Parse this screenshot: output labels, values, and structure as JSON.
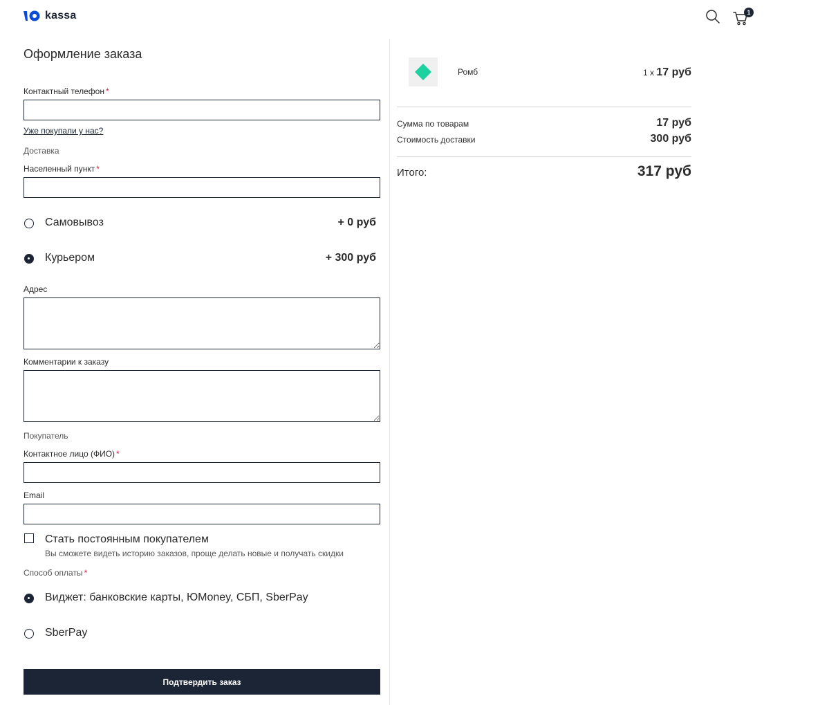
{
  "header": {
    "logo_text": "kassa",
    "logo_icon": "yookassa-logo-icon",
    "search_icon": "search-icon",
    "cart_icon": "cart-icon",
    "cart_count": "1"
  },
  "form": {
    "title": "Оформление заказа",
    "phone_label": "Контактный телефон",
    "phone_value": "",
    "returning_link": "Уже покупали у нас?",
    "delivery_section": "Доставка",
    "city_label": "Населенный пункт",
    "city_value": "",
    "delivery_options": [
      {
        "label": "Самовывоз",
        "price": "+ 0 руб",
        "selected": false
      },
      {
        "label": "Курьером",
        "price": "+ 300 руб",
        "selected": true
      }
    ],
    "address_label": "Адрес",
    "address_value": "",
    "comment_label": "Комментарии к заказу",
    "comment_value": "",
    "buyer_section": "Покупатель",
    "name_label": "Контактное лицо (ФИО)",
    "name_value": "",
    "email_label": "Email",
    "email_value": "",
    "regular_label": "Стать постоянным покупателем",
    "regular_hint": "Вы сможете видеть историю заказов, проще делать новые и получать скидки",
    "regular_checked": false,
    "payment_label": "Способ оплаты",
    "payment_options": [
      {
        "label": "Виджет: банковские карты, ЮMoney, СБП, SberPay",
        "selected": true
      },
      {
        "label": "SberPay",
        "selected": false
      }
    ],
    "required_mark": "*",
    "submit_label": "Подтвердить заказ"
  },
  "summary": {
    "item": {
      "name": "Ромб",
      "qty": "1 x",
      "price": "17 руб",
      "thumb_icon": "diamond-icon",
      "thumb_color": "#1dd1a1"
    },
    "subtotal_label": "Сумма по товарам",
    "subtotal_value": "17 руб",
    "delivery_label": "Стоимость доставки",
    "delivery_value": "300 руб",
    "total_label": "Итого:",
    "total_value": "317 руб"
  },
  "colors": {
    "primary": "#1c2536",
    "required": "#d6213a",
    "logo_blue": "#0a4cd8"
  }
}
